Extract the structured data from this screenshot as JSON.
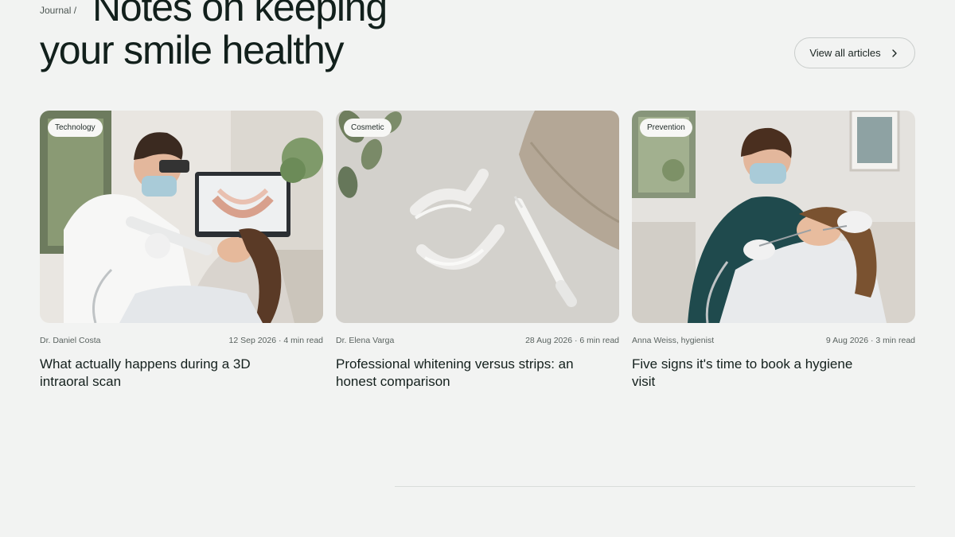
{
  "breadcrumb": "Journal /",
  "title": {
    "line1": "Notes on keeping",
    "line2": "your smile healthy"
  },
  "view_all": {
    "label": "View all articles",
    "icon": "chevron-right-icon"
  },
  "articles": [
    {
      "tag": "Technology",
      "author": "Dr. Daniel Costa",
      "date": "12 Sep 2026 · 4 min read",
      "headline": "What actually happens during a 3D intraoral scan",
      "image": "dentist-intraoral-scan-photo"
    },
    {
      "tag": "Cosmetic",
      "author": "Dr. Elena Varga",
      "date": "28 Aug 2026 · 6 min read",
      "headline": "Professional whitening versus strips: an honest comparison",
      "image": "clear-aligners-syringe-photo"
    },
    {
      "tag": "Prevention",
      "author": "Anna Weiss, hygienist",
      "date": "9 Aug 2026 · 3 min read",
      "headline": "Five signs it's time to book a hygiene visit",
      "image": "hygienist-cleaning-photo"
    }
  ]
}
